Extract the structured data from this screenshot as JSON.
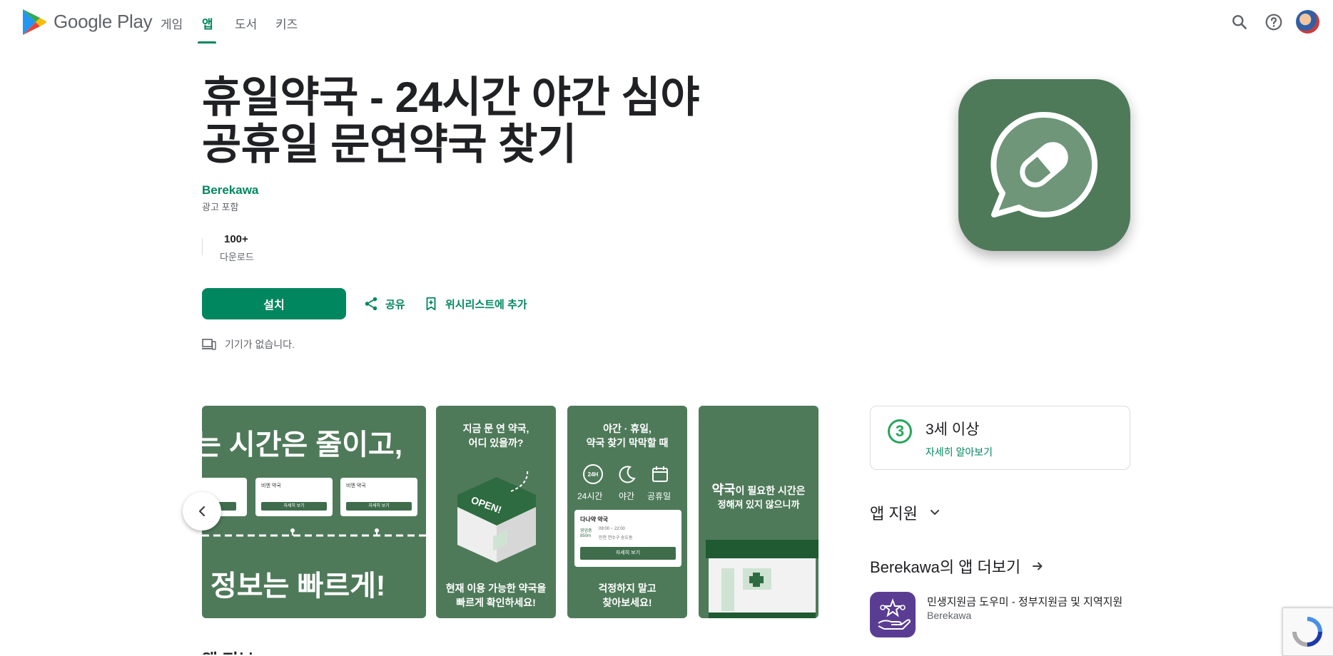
{
  "header": {
    "brand": "Google Play",
    "nav": [
      {
        "label": "게임",
        "active": false
      },
      {
        "label": "앱",
        "active": true
      },
      {
        "label": "도서",
        "active": false
      },
      {
        "label": "키즈",
        "active": false
      }
    ],
    "accent_color": "#01875f"
  },
  "app": {
    "title_line1": "휴일약국 - 24시간 야간 심야",
    "title_line2": "공휴일 문연약국 찾기",
    "developer": "Berekawa",
    "ads_note": "광고 포함",
    "downloads_value": "100+",
    "downloads_label": "다운로드",
    "install_label": "설치",
    "share_label": "공유",
    "wishlist_label": "위시리스트에 추가",
    "device_note": "기기가 없습니다.",
    "icon_color": "#4f7a5a"
  },
  "screenshots": {
    "shot1": {
      "headline": "는 시간은 줄이고,",
      "footer": "정보는 빠르게!",
      "card_title": "비엔 약국",
      "card_button": "자세히 보기"
    },
    "shot2": {
      "top_line1": "지금 문 연 약국,",
      "top_line2": "어디 있을까?",
      "sign": "OPEN!",
      "bottom_line1": "현재 이용 가능한 약국을",
      "bottom_line2": "빠르게 확인하세요!"
    },
    "shot3": {
      "top_line1": "야간 · 휴일,",
      "top_line2": "약국 찾기 막막할 때",
      "badge_24h": "24H",
      "feature1": "24시간",
      "feature2": "야간",
      "feature3": "공휴일",
      "card_title": "다나약 약국",
      "card_hours_label": "영업중",
      "card_hours": "09:00 ~ 22:00",
      "card_distance": "850m",
      "card_address": "인천 연수구 송도동",
      "card_button": "자세히 보기",
      "bottom_line1": "걱정하지 말고",
      "bottom_line2": "찾아보세요!"
    },
    "shot4": {
      "highlight": "약국",
      "line1_rest": "이 필요한 시간은",
      "line2": "정해져 있지 않으니까"
    },
    "next_section": "앱 정보"
  },
  "sidebar": {
    "rating_badge": "3",
    "rating_title": "3세 이상",
    "rating_link": "자세히 알아보기",
    "app_support": "앱 지원",
    "more_from": "Berekawa의 앱 더보기",
    "more_app": {
      "name": "민생지원금 도우미 - 정부지원금 및 지역지원",
      "developer": "Berekawa",
      "icon_color": "#5a3d93"
    }
  }
}
